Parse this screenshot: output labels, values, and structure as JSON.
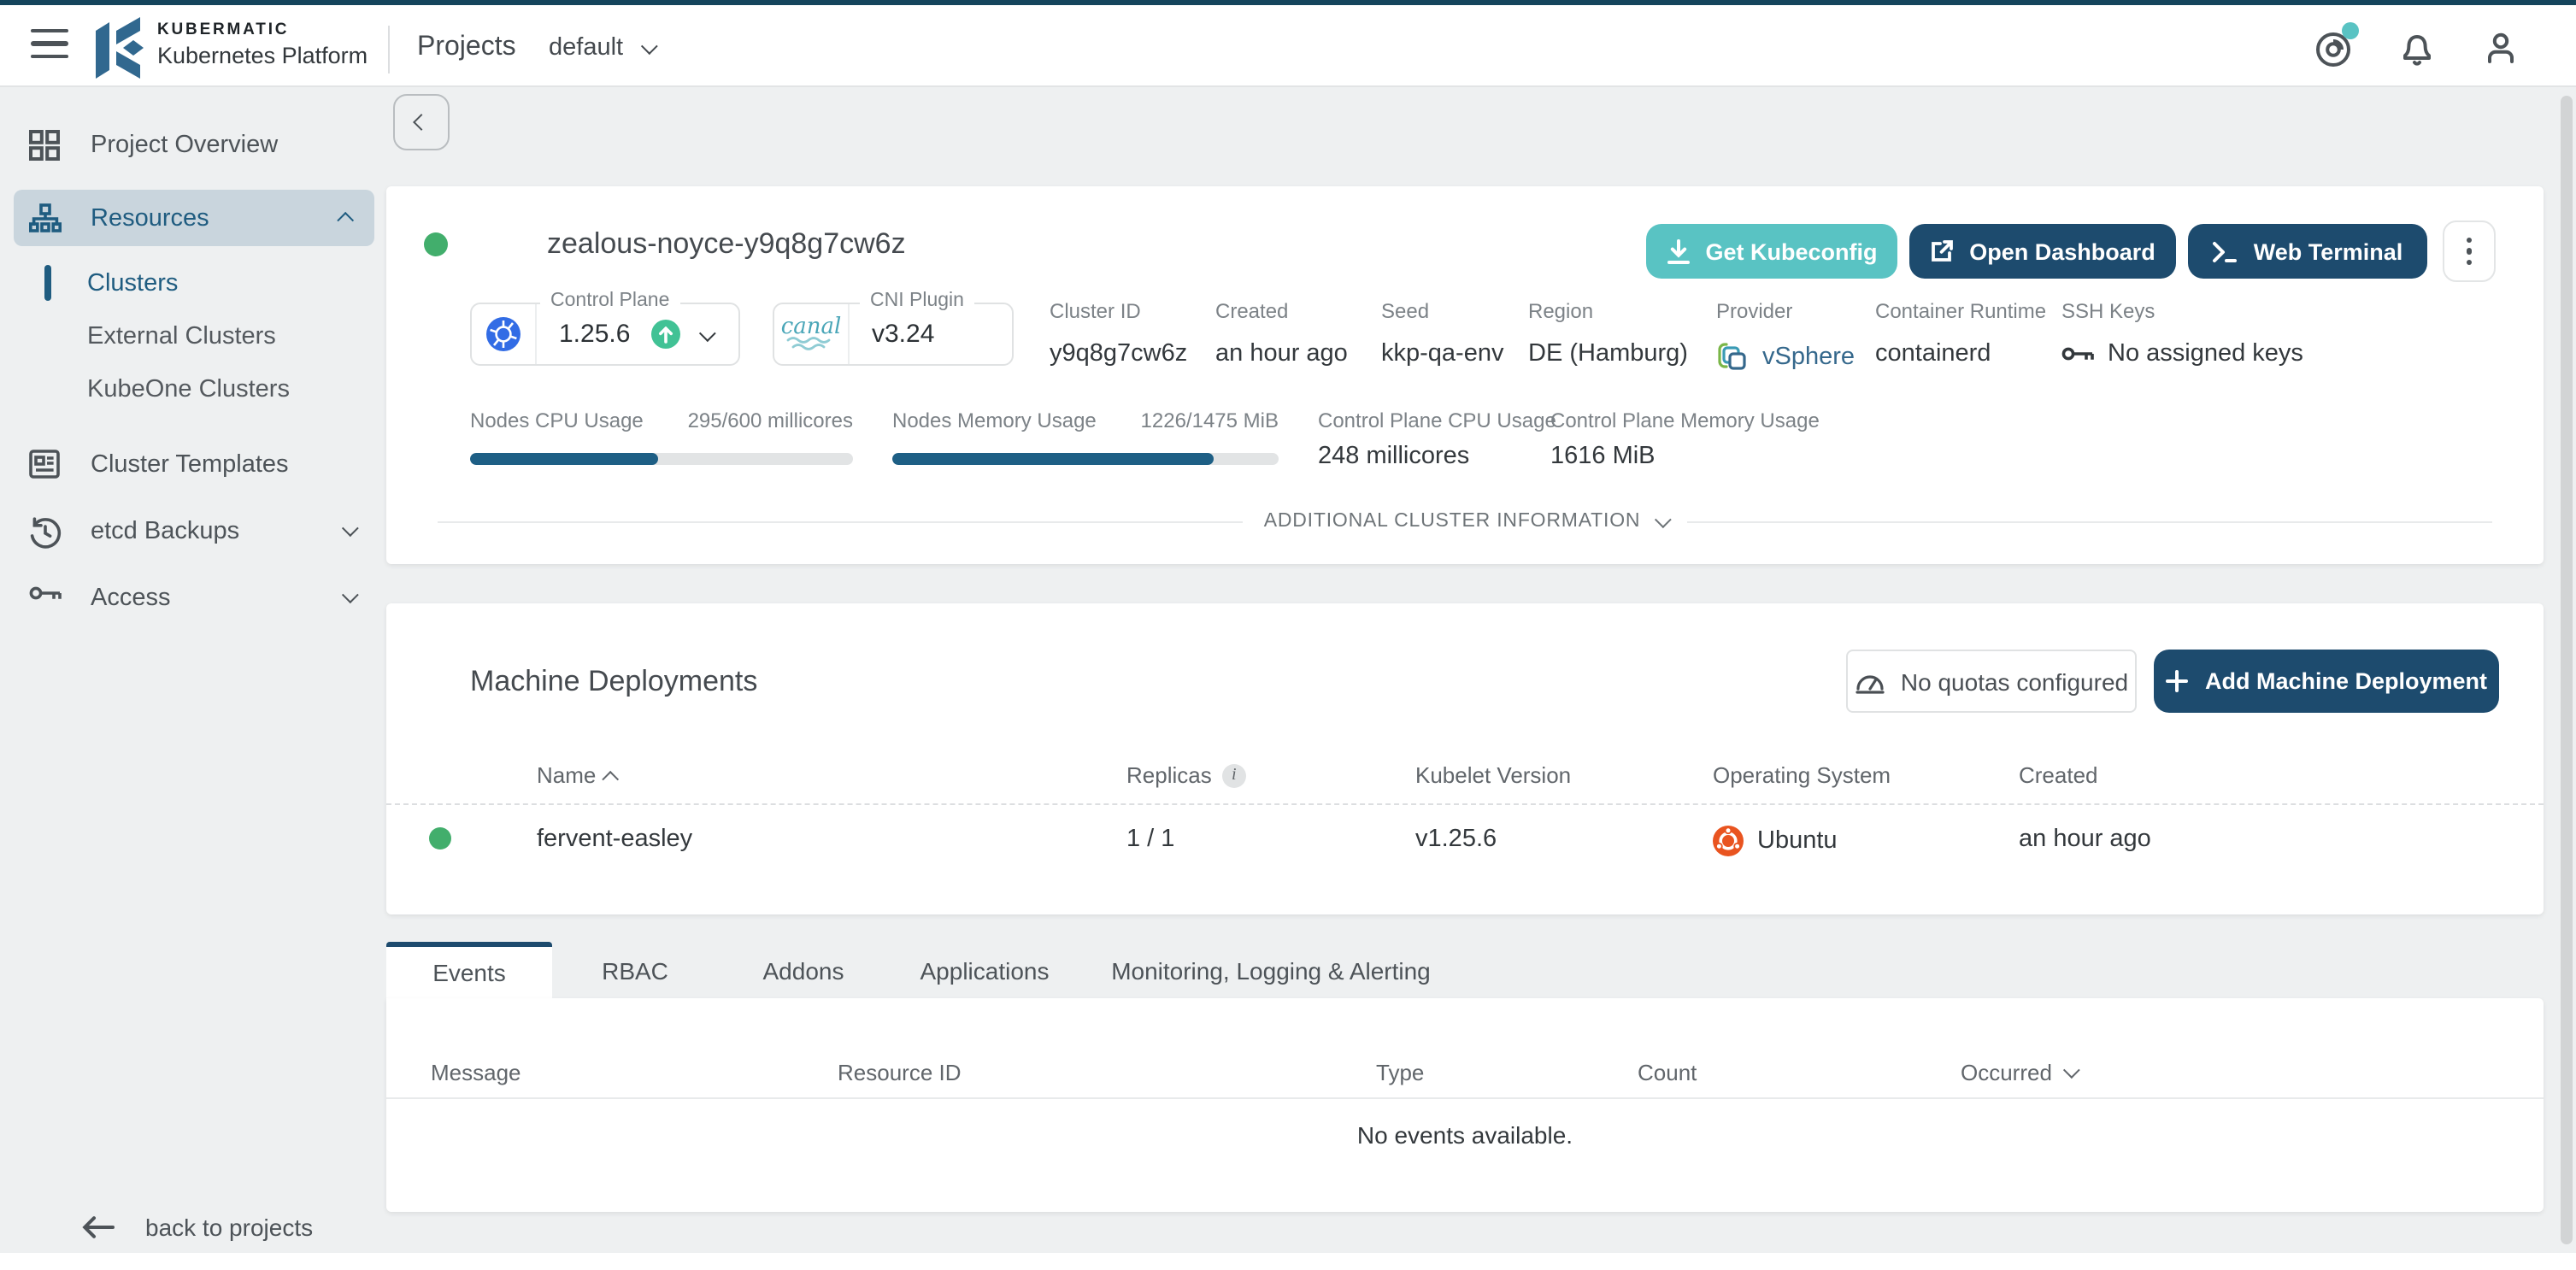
{
  "header": {
    "brand_line1": "KUBERMATIC",
    "brand_line2": "Kubernetes Platform",
    "nav_title": "Projects",
    "project_selector": "default"
  },
  "sidebar": {
    "items": [
      {
        "label": "Project Overview"
      },
      {
        "label": "Resources"
      },
      {
        "label": "Clusters"
      },
      {
        "label": "External Clusters"
      },
      {
        "label": "KubeOne Clusters"
      },
      {
        "label": "Cluster Templates"
      },
      {
        "label": "etcd Backups"
      },
      {
        "label": "Access"
      }
    ],
    "back_link": "back to projects"
  },
  "cluster": {
    "title": "zealous-noyce-y9q8g7cw6z",
    "status": "running",
    "actions": {
      "get_kubeconfig": "Get Kubeconfig",
      "open_dashboard": "Open Dashboard",
      "web_terminal": "Web Terminal"
    },
    "control_plane": {
      "label": "Control Plane",
      "version": "1.25.6"
    },
    "cni_plugin": {
      "label": "CNI Plugin",
      "logo_text": "canal",
      "version": "v3.24"
    },
    "fields": [
      {
        "label": "Cluster ID",
        "value": "y9q8g7cw6z"
      },
      {
        "label": "Created",
        "value": "an hour ago"
      },
      {
        "label": "Seed",
        "value": "kkp-qa-env"
      },
      {
        "label": "Region",
        "value": "DE (Hamburg)"
      },
      {
        "label": "Provider",
        "value": "vSphere"
      },
      {
        "label": "Container Runtime",
        "value": "containerd"
      },
      {
        "label": "SSH Keys",
        "value": "No assigned keys"
      }
    ],
    "usage": {
      "nodes_cpu": {
        "label": "Nodes CPU Usage",
        "value": "295/600 millicores",
        "percent": 49
      },
      "nodes_memory": {
        "label": "Nodes Memory Usage",
        "value": "1226/1475 MiB",
        "percent": 83
      },
      "cp_cpu": {
        "label": "Control Plane CPU Usage",
        "value": "248 millicores"
      },
      "cp_memory": {
        "label": "Control Plane Memory Usage",
        "value": "1616 MiB"
      }
    },
    "additional_info_label": "ADDITIONAL CLUSTER INFORMATION"
  },
  "machine_deployments": {
    "title": "Machine Deployments",
    "quota_note": "No quotas configured",
    "add_button": "Add Machine Deployment",
    "columns": [
      "Name",
      "Replicas",
      "Kubelet Version",
      "Operating System",
      "Created"
    ],
    "rows": [
      {
        "name": "fervent-easley",
        "replicas": "1 / 1",
        "kubelet_version": "v1.25.6",
        "operating_system": "Ubuntu",
        "created": "an hour ago",
        "status": "running"
      }
    ]
  },
  "tabs": [
    "Events",
    "RBAC",
    "Addons",
    "Applications",
    "Monitoring, Logging & Alerting"
  ],
  "events": {
    "columns": [
      "Message",
      "Resource ID",
      "Type",
      "Count",
      "Occurred"
    ],
    "empty_message": "No events available."
  },
  "colors": {
    "accent_teal": "#59c3c3",
    "navy": "#1d4b6e",
    "steel_blue": "#1f5c80",
    "status_green": "#42ae6c",
    "ubuntu_orange": "#e95420",
    "kubernetes_blue": "#326ce5"
  }
}
